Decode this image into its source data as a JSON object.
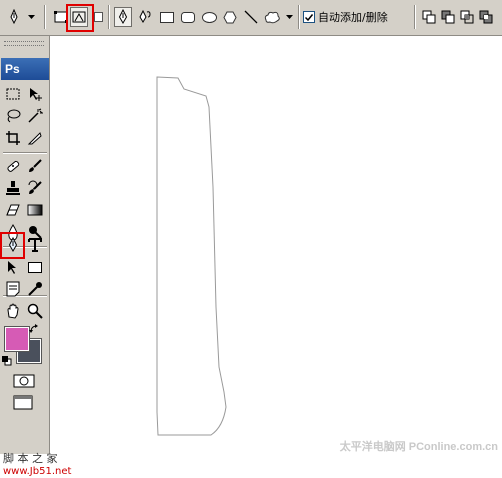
{
  "options_bar": {
    "auto_add_delete_label": "自动添加/删除",
    "auto_add_delete_checked": true
  },
  "toolbox": {
    "logo_text": "Ps",
    "foreground_color": "#d65bb5",
    "background_color": "#4a505c"
  },
  "watermarks": {
    "left_line1": "脚 本 之 家",
    "left_line2": "www.Jb51.net",
    "right": "太平洋电脑网 PConline.com.cn"
  },
  "colors": {
    "ui_gray": "#d4d0c8",
    "highlight_red": "#e00000",
    "path_stroke": "#9a9a9a"
  },
  "icons": [
    "pen-tool-icon",
    "shape-layers-icon",
    "paths-icon",
    "fill-pixels-icon",
    "pen-icon",
    "freeform-pen-icon",
    "rectangle-icon",
    "rounded-rectangle-icon",
    "ellipse-icon",
    "polygon-icon",
    "line-icon",
    "custom-shape-icon",
    "add-to-area-icon",
    "subtract-icon",
    "intersect-icon",
    "exclude-icon"
  ]
}
